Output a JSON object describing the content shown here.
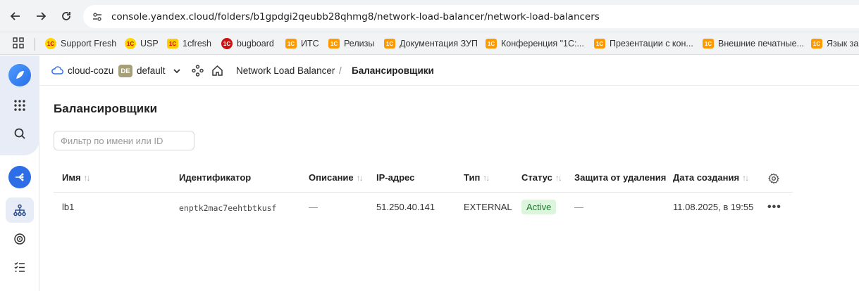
{
  "browser": {
    "url": "console.yandex.cloud/folders/b1gpdgi2qeubb28qhmg8/network-load-balancer/network-load-balancers"
  },
  "bookmarks": [
    {
      "label": "Support Fresh",
      "icon": "1c-icon"
    },
    {
      "label": "USP",
      "icon": "1c-icon"
    },
    {
      "label": "1cfresh",
      "icon": "1c-icon"
    },
    {
      "label": "bugboard",
      "icon": "1c-red-icon"
    },
    {
      "label": "ИТС",
      "icon": "1c-icon"
    },
    {
      "label": "Релизы",
      "icon": "1c-icon"
    },
    {
      "label": "Документация ЗУП",
      "icon": "1c-icon"
    },
    {
      "label": "Конференция \"1С:...",
      "icon": "1c-icon"
    },
    {
      "label": "Презентации с кон...",
      "icon": "1c-icon"
    },
    {
      "label": "Внешние печатные...",
      "icon": "1c-icon"
    },
    {
      "label": "Язык заг",
      "icon": "1c-icon"
    }
  ],
  "favicon_text": "1С",
  "header": {
    "cloud": "cloud-cozu",
    "folder_badge": "DE",
    "folder": "default",
    "service": "Network Load Balancer",
    "separator": "/",
    "page": "Балансировщики"
  },
  "main": {
    "title": "Балансировщики",
    "filter_placeholder": "Фильтр по имени или ID",
    "columns": [
      "Имя",
      "Идентификатор",
      "Описание",
      "IP-адрес",
      "Тип",
      "Статус",
      "Защита от удаления",
      "Дата создания"
    ],
    "sort_glyph": "↑↓",
    "rows": [
      {
        "name": "lb1",
        "id": "enptk2mac7eehtbtkusf",
        "description": "—",
        "ip": "51.250.40.141",
        "type": "EXTERNAL",
        "status": "Active",
        "deletion_protection": "—",
        "created": "11.08.2025, в 19:55",
        "more": "•••"
      }
    ]
  },
  "colors": {
    "accent": "#2d6ee6",
    "status_active_bg": "#ddf4dd",
    "status_active_fg": "#1f7a2f"
  }
}
